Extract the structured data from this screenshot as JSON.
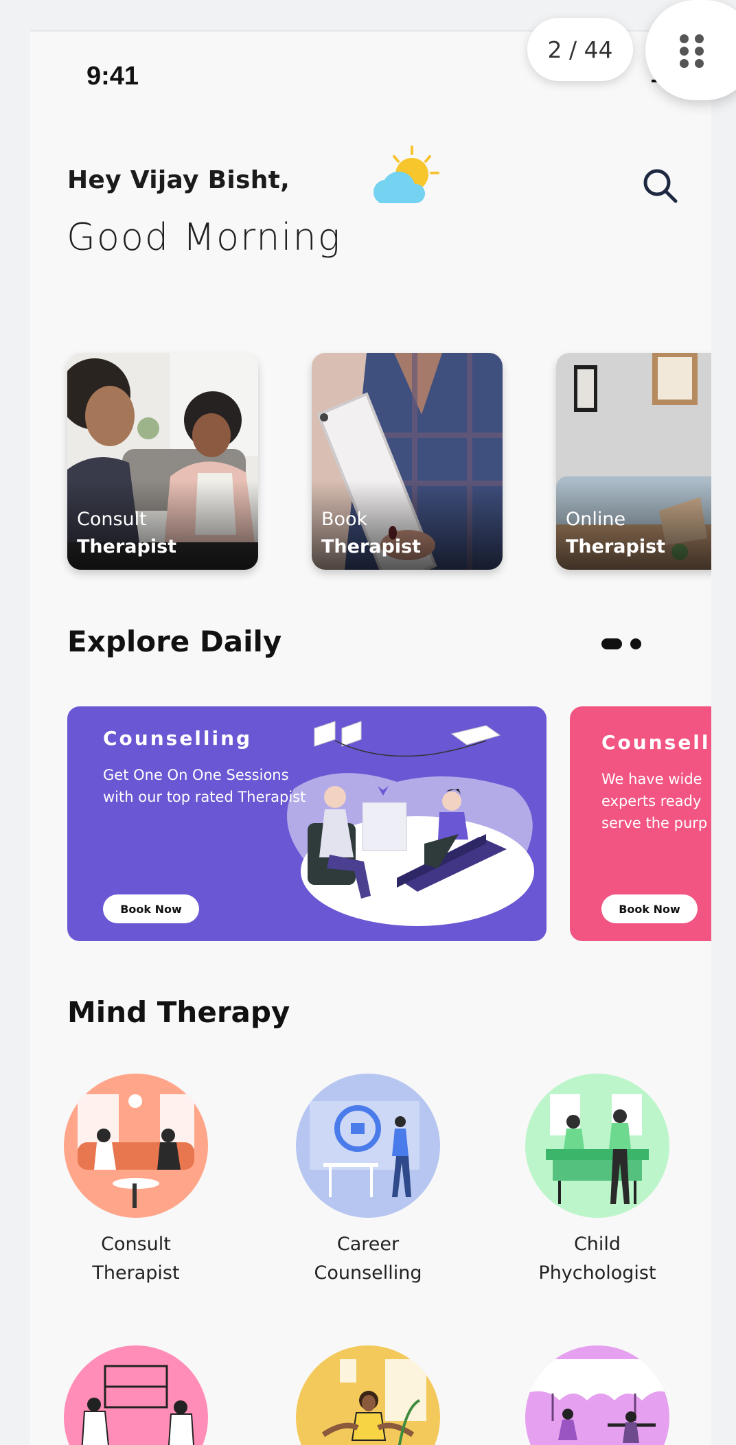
{
  "status": {
    "time": "9:41"
  },
  "viewer": {
    "page_indicator": "2 / 44"
  },
  "greeting": {
    "name": "Hey Vijay Bisht,",
    "message": "Good Morning"
  },
  "top_cards": [
    {
      "line1": "Consult",
      "line2": "Therapist"
    },
    {
      "line1": "Book",
      "line2": "Therapist"
    },
    {
      "line1": "Online",
      "line2": "Therapist"
    }
  ],
  "explore": {
    "title": "Explore Daily",
    "cards": [
      {
        "title": "Counselling",
        "description": "Get One On One Sessions with our top rated Therapist",
        "button": "Book Now",
        "color": "#6A57D3"
      },
      {
        "title": "Counselling",
        "description": "We have wide experts ready serve the purp",
        "button": "Book Now",
        "color": "#F25582"
      }
    ]
  },
  "mind_therapy": {
    "title": "Mind Therapy",
    "items": [
      {
        "label_line1": "Consult",
        "label_line2": "Therapist",
        "color": "#FFA58A"
      },
      {
        "label_line1": "Career",
        "label_line2": "Counselling",
        "color": "#B7C6F1"
      },
      {
        "label_line1": "Child",
        "label_line2": "Phychologist",
        "color": "#BDF5CB"
      },
      {
        "label_line1": "",
        "label_line2": "",
        "color": "#FF8DB7"
      },
      {
        "label_line1": "",
        "label_line2": "",
        "color": "#F4C95B"
      },
      {
        "label_line1": "",
        "label_line2": "",
        "color": "#E6A0F0"
      }
    ]
  },
  "colors": {
    "screen_bg": "#F8F8F8",
    "page_bg": "#F1F2F4",
    "text": "#111111"
  },
  "icons": [
    "weather-sun-cloud-icon",
    "search-icon",
    "grid-menu-icon"
  ]
}
